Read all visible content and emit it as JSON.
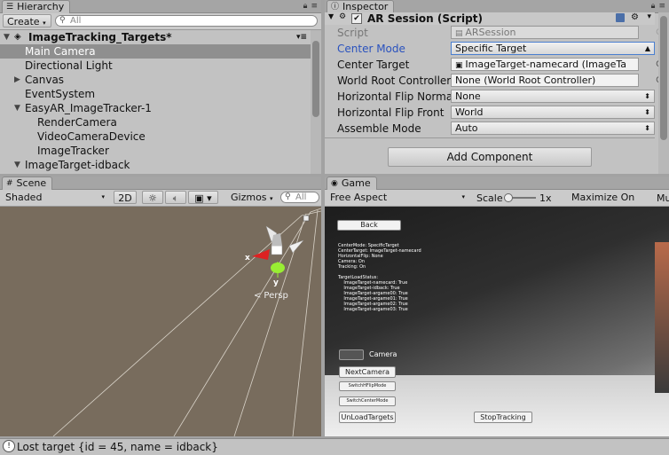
{
  "hierarchy": {
    "tab_label": "Hierarchy",
    "create_label": "Create",
    "search_placeholder": "All",
    "scene_name": "ImageTracking_Targets*",
    "items": [
      {
        "label": "Main Camera"
      },
      {
        "label": "Directional Light"
      },
      {
        "label": "Canvas"
      },
      {
        "label": "EventSystem"
      },
      {
        "label": "EasyAR_ImageTracker-1"
      },
      {
        "label": "RenderCamera"
      },
      {
        "label": "VideoCameraDevice"
      },
      {
        "label": "ImageTracker"
      },
      {
        "label": "ImageTarget-idback"
      }
    ]
  },
  "inspector": {
    "tab_label": "Inspector",
    "component_title": "AR Session (Script)",
    "rows": [
      {
        "label": "Script",
        "value": "ARSession"
      },
      {
        "label": "Center Mode",
        "value": "Specific Target"
      },
      {
        "label": "Center Target",
        "value": "ImageTarget-namecard (ImageTa"
      },
      {
        "label": "World Root Controller",
        "value": "None (World Root Controller)"
      },
      {
        "label": "Horizontal Flip Normal",
        "value": "None"
      },
      {
        "label": "Horizontal Flip Front",
        "value": "World"
      },
      {
        "label": "Assemble Mode",
        "value": "Auto"
      }
    ],
    "add_component_label": "Add Component"
  },
  "scene": {
    "tab_label": "Scene",
    "shading_mode": "Shaded",
    "mode_2d_label": "2D",
    "gizmos_label": "Gizmos",
    "search_placeholder": "All",
    "persp_label": "Persp",
    "axis_x": "x",
    "axis_y": "y"
  },
  "game": {
    "tab_label": "Game",
    "aspect": "Free Aspect",
    "scale_label": "Scale",
    "scale_value": "1x",
    "maximize_label": "Maximize On Play",
    "more_label": "Mu",
    "back_button": "Back",
    "info_text": "CenterMode: SpecificTarget\nCenterTarget: ImageTarget-namecard\nHorizontalFlip: None\nCamera: On\nTracking: On\n\nTargetLoadStatus:\n    ImageTarget-namecard: True\n    ImageTarget-idback: True\n    ImageTarget-argame00: True\n    ImageTarget-argame01: True\n    ImageTarget-argame02: True\n    ImageTarget-argame03: True",
    "camera_toggle_label": "Camera",
    "buttons": {
      "next_camera": "NextCamera",
      "switch_hflip": "SwitchHFlipMode",
      "switch_center": "SwitchCenterMode",
      "unload_targets": "UnLoadTargets",
      "stop_tracking": "StopTracking"
    }
  },
  "status_bar": {
    "message": "Lost target {id = 45, name = idback}"
  },
  "colors": {
    "panel_bg": "#c2c2c2",
    "selection": "#8f8f8f",
    "link_blue": "#2a52be",
    "scene_bg": "#786c5d",
    "game_bg": "#3a3a3a"
  }
}
